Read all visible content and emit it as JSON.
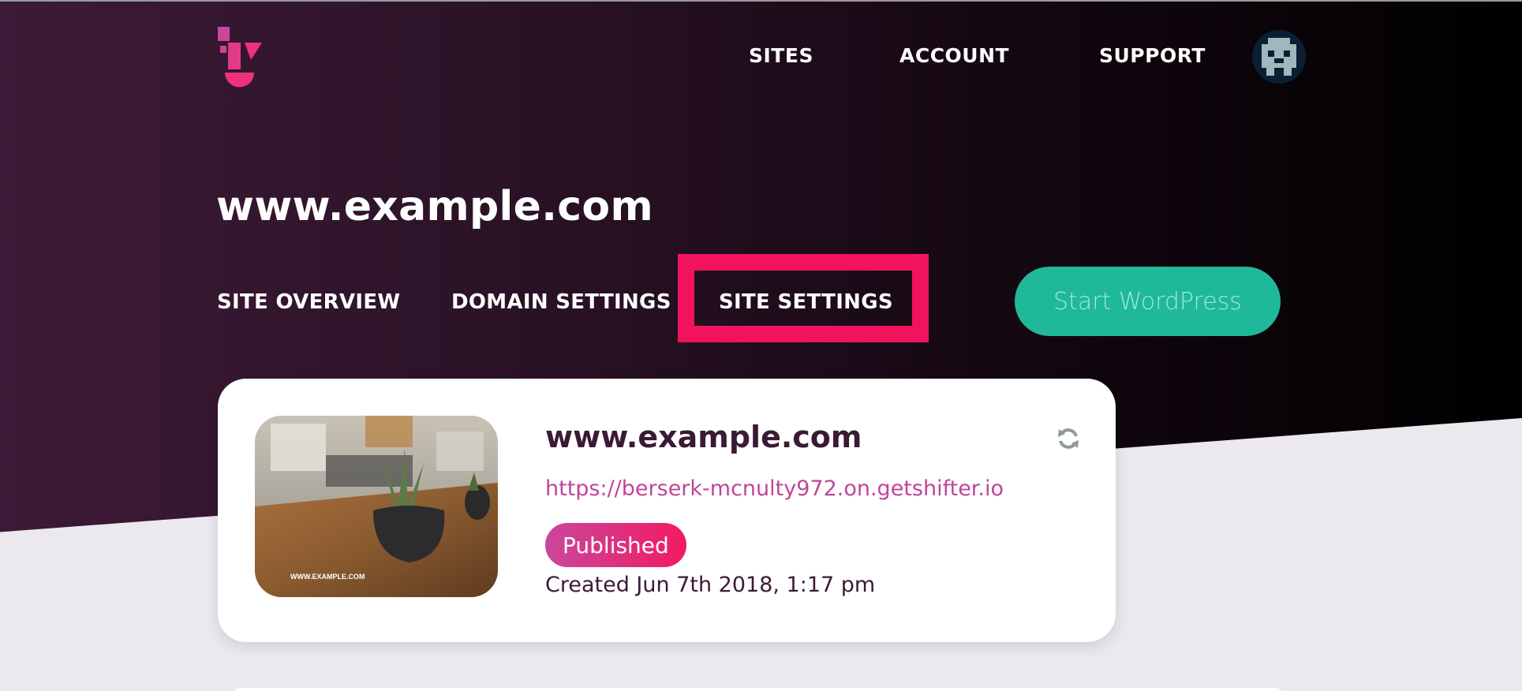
{
  "header": {
    "nav": [
      {
        "label": "SITES"
      },
      {
        "label": "ACCOUNT"
      },
      {
        "label": "SUPPORT"
      }
    ]
  },
  "site": {
    "title": "www.example.com",
    "tabs": [
      {
        "label": "SITE OVERVIEW"
      },
      {
        "label": "DOMAIN SETTINGS"
      },
      {
        "label": "SITE SETTINGS"
      }
    ],
    "start_button": "Start WordPress"
  },
  "card": {
    "title": "www.example.com",
    "url": "https://berserk-mcnulty972.on.getshifter.io",
    "status": "Published",
    "created": "Created Jun 7th 2018, 1:17 pm",
    "thumbnail_caption": "WWW.EXAMPLE.COM"
  },
  "colors": {
    "accent_pink": "#f2135e",
    "magenta": "#c1449a",
    "teal": "#1fb89a",
    "dark_purple": "#3b1a35"
  },
  "icons": {
    "logo": "shifter-logo",
    "avatar": "pixel-avatar-icon",
    "refresh": "refresh-icon"
  }
}
